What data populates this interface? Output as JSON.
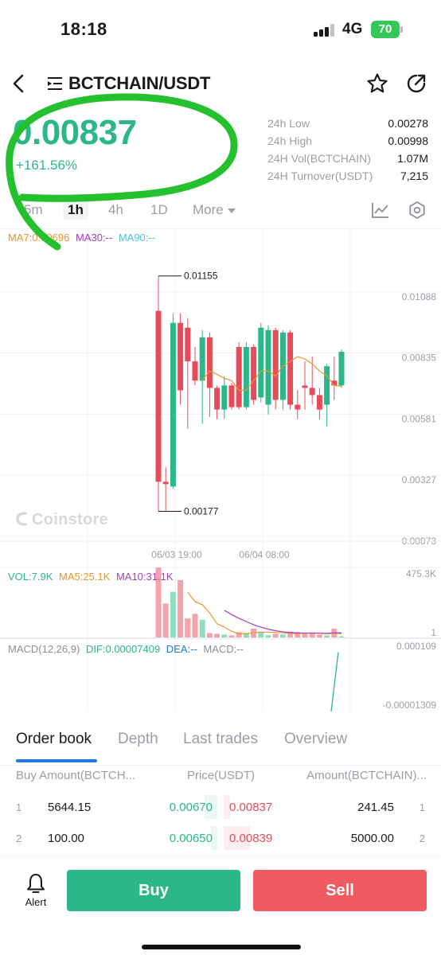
{
  "status": {
    "time": "18:18",
    "network": "4G",
    "battery": "70"
  },
  "header": {
    "pair": "BCTCHAIN/USDT"
  },
  "ticker": {
    "price": "0.00837",
    "change": "+161.56%",
    "stats": [
      {
        "label": "24h Low",
        "value": "0.00278"
      },
      {
        "label": "24h High",
        "value": "0.00998"
      },
      {
        "label": "24H Vol(BCTCHAIN)",
        "value": "1.07M"
      },
      {
        "label": "24H Turnover(USDT)",
        "value": "7,215"
      }
    ]
  },
  "timeframes": {
    "items": [
      "5m",
      "1h",
      "4h",
      "1D"
    ],
    "more": "More",
    "selected": "1h"
  },
  "chart_legend": {
    "ma7": "MA7:0.00696",
    "ma30": "MA30:--",
    "ma90": "MA90:--",
    "vol": "VOL:7.9K",
    "ma5": "MA5:25.1K",
    "ma10": "MA10:31.1K",
    "macd": "MACD(12,26,9)",
    "dif": "DIF:0.00007409",
    "dea": "DEA:--",
    "macd_val": "MACD:--"
  },
  "watermark": "Coinstore",
  "colors": {
    "up": "#2cb68a",
    "down": "#e64c58",
    "ma7": "#e8962e",
    "ma30": "#a23fb8",
    "ma90": "#4fc3d8",
    "accent": "#1e7bd8"
  },
  "chart_data": {
    "type": "candlestick",
    "price_axis": [
      "0.01088",
      "0.00835",
      "0.00581",
      "0.00327",
      "0.00073"
    ],
    "price_axis_values": [
      0.01088,
      0.00835,
      0.00581,
      0.00327,
      0.00073
    ],
    "ylim": [
      0.00073,
      0.01342
    ],
    "time_axis": [
      "06/03 19:00",
      "06/04 08:00"
    ],
    "annotations": {
      "high": "0.01155",
      "low": "0.00177"
    },
    "candles": [
      {
        "o": 0.0101,
        "h": 0.01155,
        "l": 0.00177,
        "c": 0.003
      },
      {
        "o": 0.003,
        "h": 0.0036,
        "l": 0.0018,
        "c": 0.0029
      },
      {
        "o": 0.0028,
        "h": 0.01,
        "l": 0.0027,
        "c": 0.0096
      },
      {
        "o": 0.0096,
        "h": 0.01,
        "l": 0.0062,
        "c": 0.0068
      },
      {
        "o": 0.0094,
        "h": 0.0098,
        "l": 0.0052,
        "c": 0.008
      },
      {
        "o": 0.008,
        "h": 0.0086,
        "l": 0.007,
        "c": 0.0072
      },
      {
        "o": 0.0072,
        "h": 0.0093,
        "l": 0.0054,
        "c": 0.009
      },
      {
        "o": 0.009,
        "h": 0.0092,
        "l": 0.0057,
        "c": 0.0069
      },
      {
        "o": 0.0069,
        "h": 0.007,
        "l": 0.0056,
        "c": 0.006
      },
      {
        "o": 0.006,
        "h": 0.0074,
        "l": 0.0056,
        "c": 0.007
      },
      {
        "o": 0.007,
        "h": 0.0071,
        "l": 0.006,
        "c": 0.0061
      },
      {
        "o": 0.0086,
        "h": 0.0088,
        "l": 0.006,
        "c": 0.0061
      },
      {
        "o": 0.0061,
        "h": 0.0088,
        "l": 0.006,
        "c": 0.0086
      },
      {
        "o": 0.0086,
        "h": 0.0087,
        "l": 0.0062,
        "c": 0.0064
      },
      {
        "o": 0.0065,
        "h": 0.0096,
        "l": 0.0063,
        "c": 0.0094
      },
      {
        "o": 0.0062,
        "h": 0.0095,
        "l": 0.0058,
        "c": 0.0093
      },
      {
        "o": 0.0093,
        "h": 0.0094,
        "l": 0.006,
        "c": 0.0064
      },
      {
        "o": 0.0064,
        "h": 0.0093,
        "l": 0.006,
        "c": 0.0092
      },
      {
        "o": 0.0092,
        "h": 0.0093,
        "l": 0.006,
        "c": 0.0062
      },
      {
        "o": 0.0062,
        "h": 0.0068,
        "l": 0.0056,
        "c": 0.006
      },
      {
        "o": 0.007,
        "h": 0.008,
        "l": 0.006,
        "c": 0.0069
      },
      {
        "o": 0.0069,
        "h": 0.0082,
        "l": 0.0062,
        "c": 0.0066
      },
      {
        "o": 0.0066,
        "h": 0.0069,
        "l": 0.0056,
        "c": 0.006
      },
      {
        "o": 0.0062,
        "h": 0.0079,
        "l": 0.0053,
        "c": 0.0078
      },
      {
        "o": 0.0072,
        "h": 0.0082,
        "l": 0.0064,
        "c": 0.007
      },
      {
        "o": 0.007,
        "h": 0.0085,
        "l": 0.0069,
        "c": 0.0084
      }
    ],
    "ma7": [
      null,
      null,
      null,
      null,
      null,
      null,
      0.00722,
      0.0076,
      0.00746,
      0.0073,
      0.0072,
      0.0068,
      0.0068,
      0.0072,
      0.0076,
      0.0076,
      0.0074,
      0.0078,
      0.008,
      0.0082,
      0.0081,
      0.0079,
      0.0076,
      0.0074,
      0.007,
      0.00696
    ],
    "volume": {
      "axis_max_label": "475.3K",
      "axis_min_label": "1",
      "max": 475300,
      "bars": [
        475000,
        230000,
        310000,
        390000,
        130000,
        160000,
        120000,
        30000,
        25000,
        20000,
        15000,
        35000,
        30000,
        60000,
        40000,
        15000,
        25000,
        20000,
        40000,
        35000,
        25000,
        30000,
        20000,
        15000,
        60000,
        8000
      ],
      "ma5": [
        null,
        null,
        null,
        null,
        307000,
        244000,
        222000,
        166000,
        93000,
        71000,
        42000,
        25000,
        25000,
        32000,
        36000,
        36000,
        34000,
        32000,
        28000,
        27000,
        29000,
        30000,
        30000,
        25000,
        30000,
        25100
      ],
      "ma10": [
        null,
        null,
        null,
        null,
        null,
        null,
        null,
        null,
        null,
        184000,
        155000,
        130000,
        108000,
        86000,
        70000,
        56000,
        46000,
        38000,
        33000,
        31000,
        30000,
        30000,
        29000,
        28000,
        31000,
        31100
      ]
    },
    "macd": {
      "axis_top": "0.000109",
      "axis_bottom": "-0.00001309",
      "top": 0.000109,
      "bottom": -1.309e-05,
      "dif_tail": [
        -1.309e-05,
        7.409e-05
      ]
    }
  },
  "orderbook": {
    "tabs": [
      "Order book",
      "Depth",
      "Last trades",
      "Overview"
    ],
    "columns": {
      "buy": "Buy Amount(BCTCH...",
      "price": "Price(USDT)",
      "sell": "Amount(BCTCHAIN)..."
    },
    "rows": [
      {
        "idx": "1",
        "buy_amount": "5644.15",
        "bid": "0.00670",
        "ask": "0.00837",
        "sell_amount": "241.45",
        "idx2": "1",
        "bid_depth": 0.06,
        "ask_depth": 0.03
      },
      {
        "idx": "2",
        "buy_amount": "100.00",
        "bid": "0.00650",
        "ask": "0.00839",
        "sell_amount": "5000.00",
        "idx2": "2",
        "bid_depth": 0.03,
        "ask_depth": 0.12
      }
    ]
  },
  "bottom": {
    "alert": "Alert",
    "buy": "Buy",
    "sell": "Sell"
  }
}
